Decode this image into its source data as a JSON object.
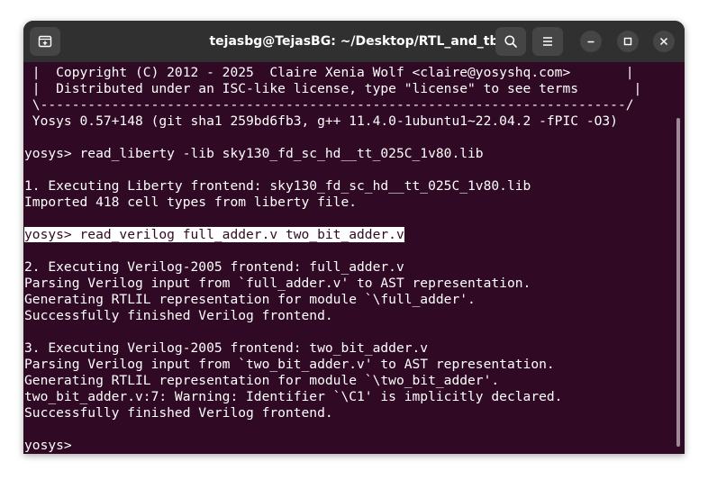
{
  "window": {
    "title": "tejasbg@TejasBG: ~/Desktop/RTL_and_tb"
  },
  "colors": {
    "terminal_bg": "#300a24",
    "titlebar_bg": "#303030",
    "text": "#ffffff"
  },
  "icons": {
    "new_tab": "new-tab-icon",
    "search": "search-icon",
    "menu": "hamburger-menu-icon",
    "minimize": "minimize-icon",
    "maximize": "maximize-icon",
    "close": "close-icon"
  },
  "terminal": {
    "lines": [
      " |  Copyright (C) 2012 - 2025  Claire Xenia Wolf <claire@yosyshq.com>       |",
      " |  Distributed under an ISC-like license, type \"license\" to see terms       |",
      " \\--------------------------------------------------------------------------/",
      " Yosys 0.57+148 (git sha1 259bd6fb3, g++ 11.4.0-1ubuntu1~22.04.2 -fPIC -O3)",
      "",
      "yosys> read_liberty -lib sky130_fd_sc_hd__tt_025C_1v80.lib",
      "",
      "1. Executing Liberty frontend: sky130_fd_sc_hd__tt_025C_1v80.lib",
      "Imported 418 cell types from liberty file.",
      "",
      "yosys> read_verilog full_adder.v two_bit_adder.v",
      "",
      "2. Executing Verilog-2005 frontend: full_adder.v",
      "Parsing Verilog input from `full_adder.v' to AST representation.",
      "Generating RTLIL representation for module `\\full_adder'.",
      "Successfully finished Verilog frontend.",
      "",
      "3. Executing Verilog-2005 frontend: two_bit_adder.v",
      "Parsing Verilog input from `two_bit_adder.v' to AST representation.",
      "Generating RTLIL representation for module `\\two_bit_adder'.",
      "two_bit_adder.v:7: Warning: Identifier `\\C1' is implicitly declared.",
      "Successfully finished Verilog frontend.",
      "",
      "yosys>"
    ],
    "highlighted_line_index": 10
  }
}
